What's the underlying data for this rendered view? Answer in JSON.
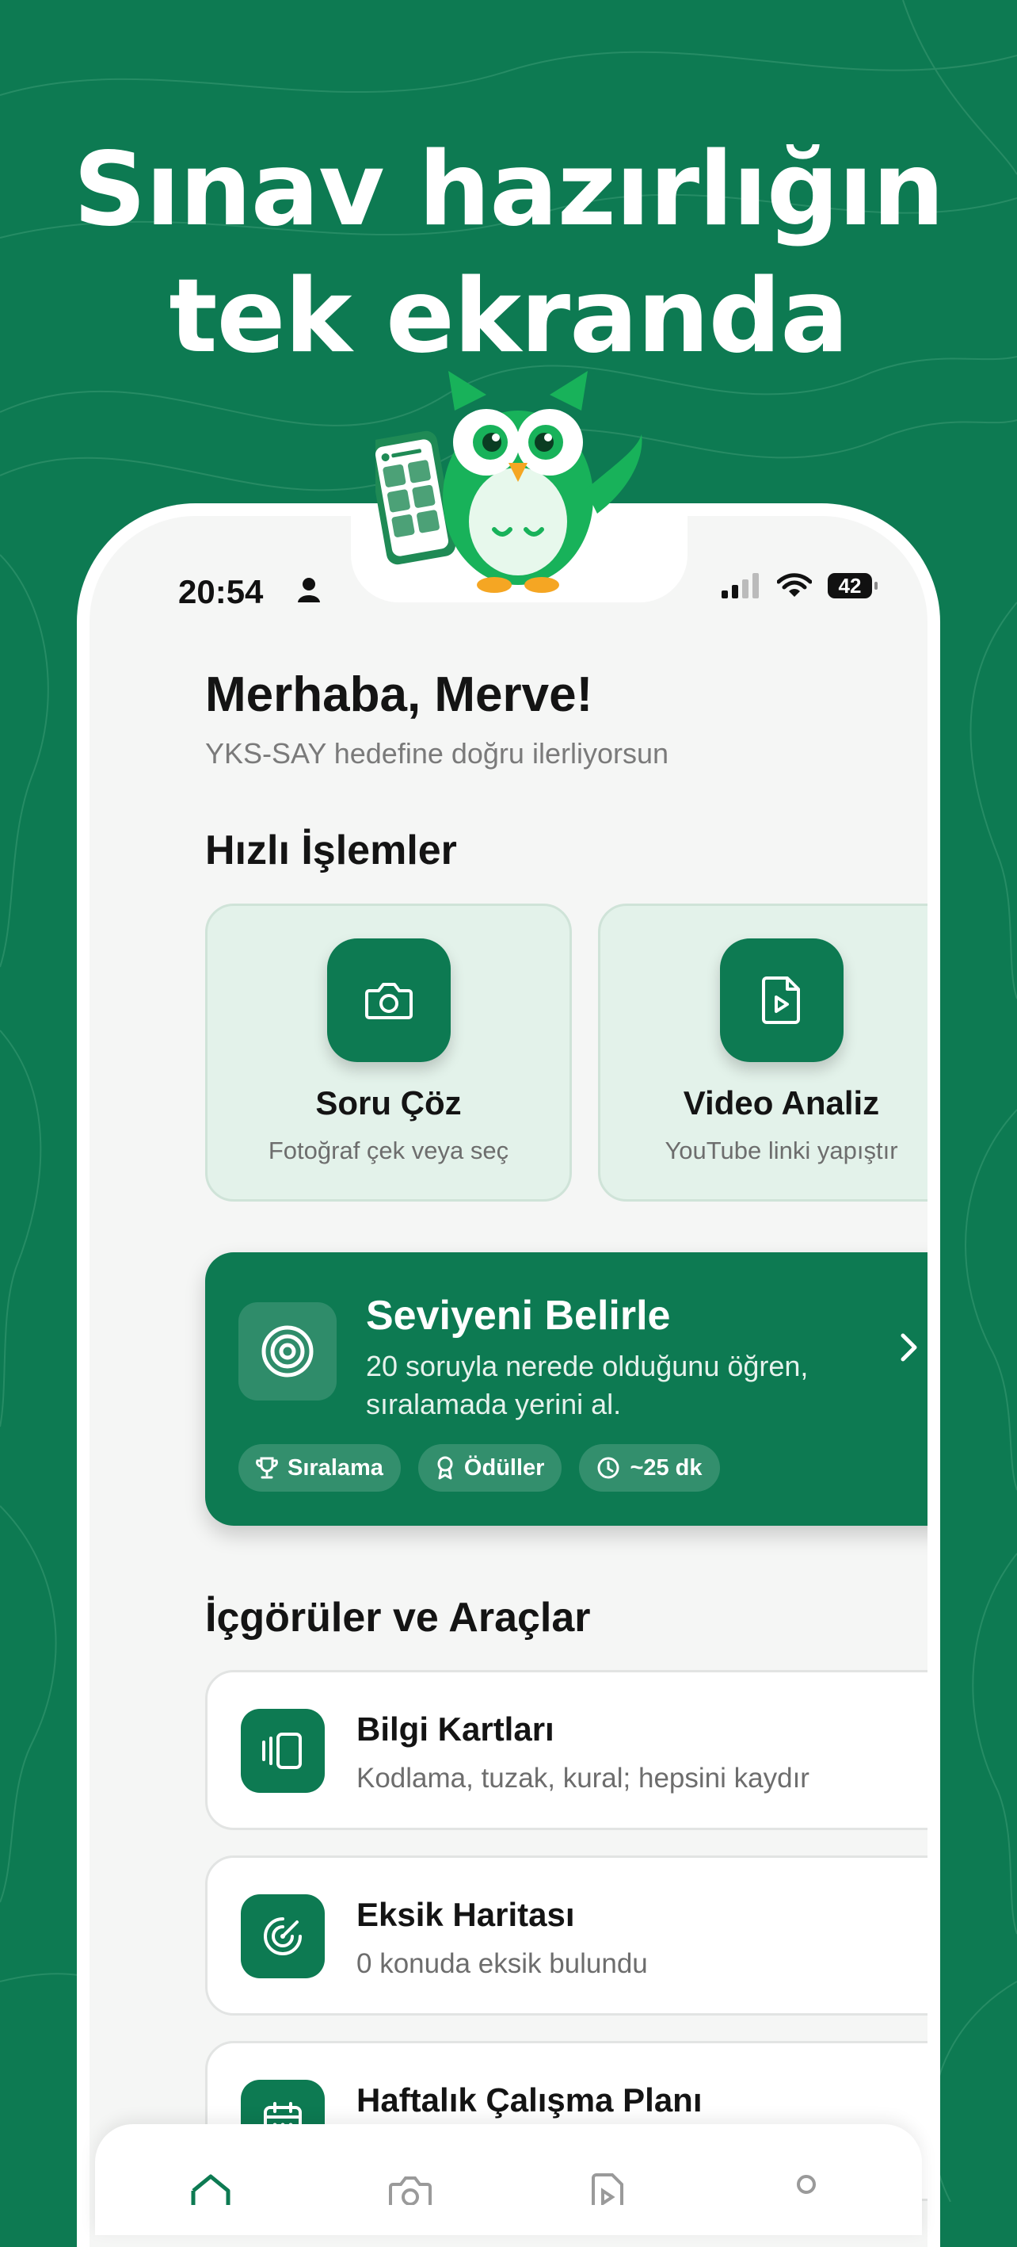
{
  "hero": {
    "line1": "Sınav hazırlığın",
    "line2": "tek ekranda"
  },
  "status_bar": {
    "time": "20:54",
    "battery": "42"
  },
  "greeting": {
    "title": "Merhaba, Merve!",
    "subtitle": "YKS-SAY hedefine doğru ilerliyorsun"
  },
  "quick_actions": {
    "title": "Hızlı İşlemler",
    "items": [
      {
        "title": "Soru Çöz",
        "subtitle": "Fotoğraf çek veya seç",
        "icon": "camera-icon"
      },
      {
        "title": "Video Analiz",
        "subtitle": "YouTube linki yapıştır",
        "icon": "video-file-icon"
      }
    ]
  },
  "level_card": {
    "title": "Seviyeni Belirle",
    "subtitle": "20 soruyla nerede olduğunu öğren, sıralamada yerini al.",
    "chips": [
      {
        "label": "Sıralama",
        "icon": "trophy-icon"
      },
      {
        "label": "Ödüller",
        "icon": "award-icon"
      },
      {
        "label": "~25 dk",
        "icon": "clock-icon"
      }
    ]
  },
  "insights": {
    "title": "İçgörüler ve Araçlar",
    "items": [
      {
        "title": "Bilgi Kartları",
        "subtitle": "Kodlama, tuzak, kural; hepsini kaydır",
        "icon": "cards-icon"
      },
      {
        "title": "Eksik Haritası",
        "subtitle": "0 konuda eksik bulundu",
        "icon": "radar-icon"
      },
      {
        "title": "Haftalık Çalışma Planı",
        "subtitle": "",
        "icon": "calendar-icon"
      }
    ]
  },
  "tab_bar": {
    "items": [
      "home-icon",
      "camera-icon",
      "video-file-icon",
      "profile-icon"
    ]
  },
  "colors": {
    "brand_green": "#0d7a52",
    "light_green": "#e3f2ea",
    "screen_bg": "#f5f6f5"
  }
}
